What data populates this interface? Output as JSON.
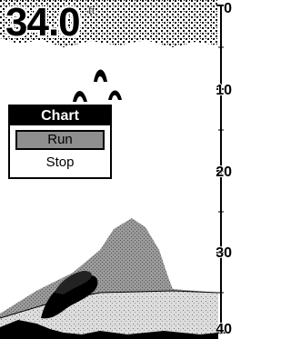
{
  "depth": {
    "value": "34.0",
    "unit": "ft"
  },
  "depth_scale": {
    "labels": [
      "0",
      "10",
      "20",
      "30",
      "40"
    ],
    "min_ft": 0,
    "max_ft": 40
  },
  "menu": {
    "title": "Chart",
    "items": [
      {
        "label": "Run",
        "selected": true
      },
      {
        "label": "Stop",
        "selected": false
      }
    ]
  },
  "colors": {
    "background": "#ffffff",
    "returns_dark": "#000000",
    "returns_mid": "#8f8f8f",
    "menu_selected": "#8f8f8f"
  },
  "icons": [
    "fish-arch-icon"
  ]
}
